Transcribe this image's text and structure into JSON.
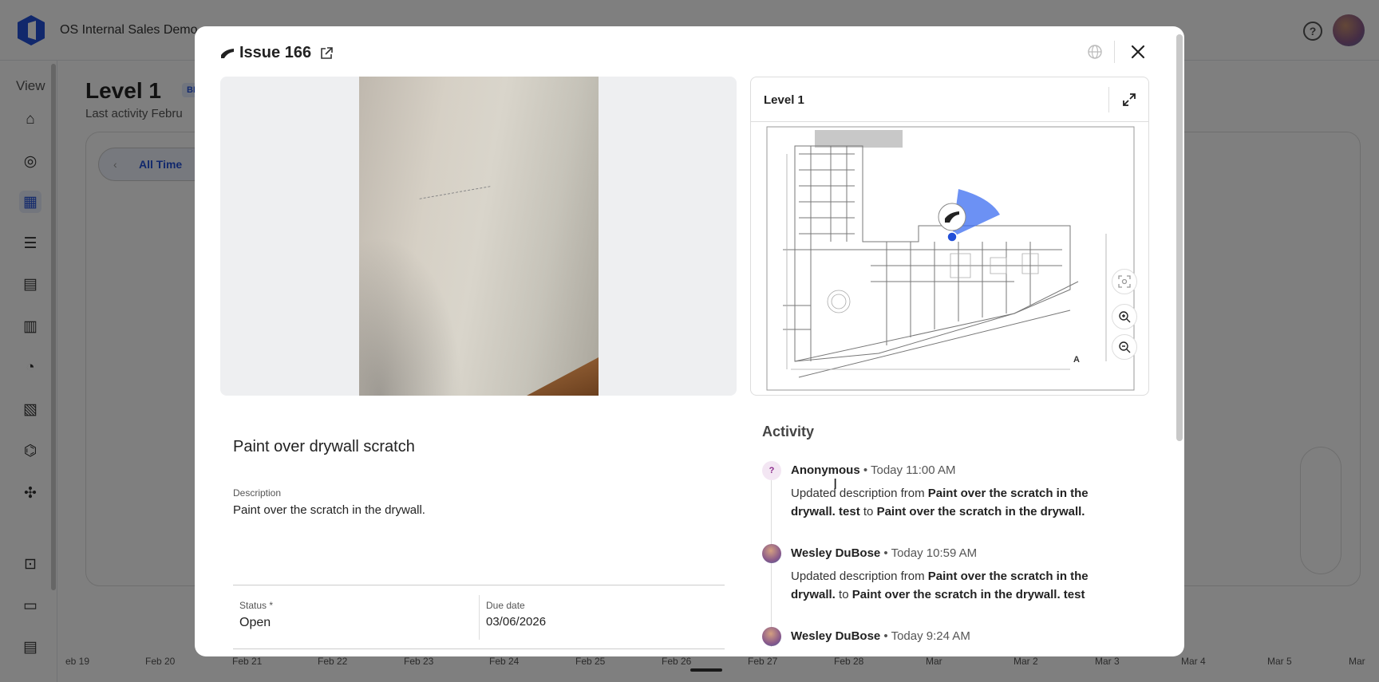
{
  "app": {
    "title": "OS Internal Sales Demo",
    "view_label": "View",
    "page_title": "Level 1",
    "badge": "BE",
    "last_activity": "Last activity Febru",
    "time_filter": "All Time"
  },
  "timeline": {
    "dates": [
      "eb 19",
      "Feb 20",
      "Feb 21",
      "Feb 22",
      "Feb 23",
      "Feb 24",
      "Feb 25",
      "Feb 26",
      "Feb 27",
      "Feb 28",
      "Mar",
      "Mar 2",
      "Mar 3",
      "Mar 4",
      "Mar 5",
      "Mar"
    ]
  },
  "modal": {
    "issue_title": "Issue 166",
    "map_level": "Level 1",
    "title": "Paint over drywall scratch",
    "description_label": "Description",
    "description": "Paint over the scratch in the drywall.",
    "status_label": "Status *",
    "status_value": "Open",
    "due_label": "Due date",
    "due_value": "03/06/2026",
    "map_corner": "A"
  },
  "activity": {
    "title": "Activity",
    "items": [
      {
        "avatar": "?",
        "user": "Anonymous",
        "time": " • Today 11:00 AM",
        "prefix": "Updated description from ",
        "from": "Paint over the scratch in the drywall. test",
        "mid": " to ",
        "to": "Paint over the scratch in the drywall."
      },
      {
        "user": "Wesley DuBose",
        "time": " • Today 10:59 AM",
        "prefix": "Updated description from ",
        "from": "Paint over the scratch in the drywall.",
        "mid": " to ",
        "to": "Paint over the scratch in the drywall. test"
      },
      {
        "user": "Wesley DuBose",
        "time": " • Today 9:24 AM"
      }
    ]
  },
  "colors": {
    "accent": "#2350d8",
    "overlay": "rgba(0,0,0,0.5)"
  }
}
